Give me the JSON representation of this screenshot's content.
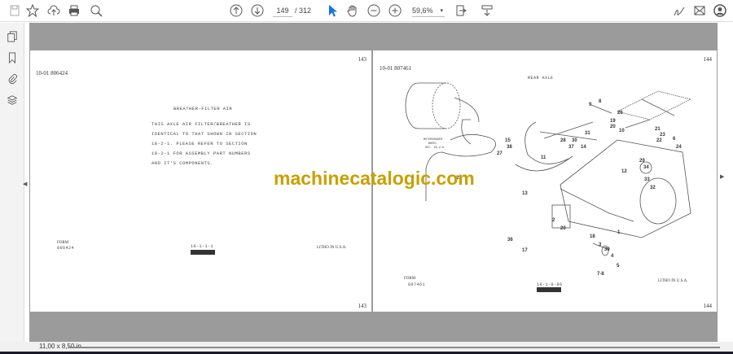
{
  "toolbar": {
    "current_page": "149",
    "total_pages": "/ 312",
    "zoom": "59,6%",
    "zoom_caret": "▾"
  },
  "icons": [
    "save-icon",
    "bookmark-star-icon",
    "upload-cloud-icon",
    "print-icon",
    "search-zoom-icon",
    "prev-page-icon",
    "next-page-icon",
    "select-cursor-icon",
    "hand-tool-icon",
    "zoom-out-icon",
    "zoom-in-icon",
    "page-fit-icon",
    "scroll-mode-icon",
    "sign-icon",
    "mail-icon",
    "account-icon"
  ],
  "accent": "#1473e6",
  "left_page": {
    "page_number": "143",
    "doc_code": "10-01  806424",
    "title": "BREATHER-FILTER AIR",
    "body": [
      "THIS AXLE AIR FILTER/BREATHER IS",
      "IDENTICAL TO THAT SHOWN IN SECTION",
      "18-2-1.  PLEASE REFER TO SECTION",
      "18-2-1 FOR ASSEMBLY PART NUMBERS",
      "AND IT'S COMPONENTS."
    ],
    "form_label": "FORM",
    "form_number": "806424",
    "section_code": "10-1-1-1",
    "litho": "LITHO IN U.S.A.",
    "page_number_bottom": "143"
  },
  "right_page": {
    "page_number": "144",
    "doc_code": "10-01  807461",
    "title": "REAR AXLE",
    "wheel_label": [
      "MOTORGRADER",
      "WHEEL",
      "SEC. 20-2-6"
    ],
    "callouts": [
      "9",
      "8",
      "26",
      "19",
      "20",
      "10",
      "21",
      "23",
      "22",
      "6",
      "24",
      "29",
      "31",
      "30",
      "28",
      "15",
      "38",
      "14",
      "37",
      "11",
      "12",
      "34",
      "33",
      "32",
      "27",
      "25",
      "13",
      "2",
      "20",
      "36",
      "17",
      "18",
      "3",
      "39",
      "4",
      "5",
      "7-8",
      "1"
    ],
    "form_label": "FORM",
    "form_number": "807461",
    "section_code": "10-1-0-96",
    "litho": "LITHO IN U.S.A.",
    "page_number_bottom": "144"
  },
  "watermark": "machinecatalogic.com",
  "status": {
    "page_size": "11,00 x 8,50 in"
  }
}
